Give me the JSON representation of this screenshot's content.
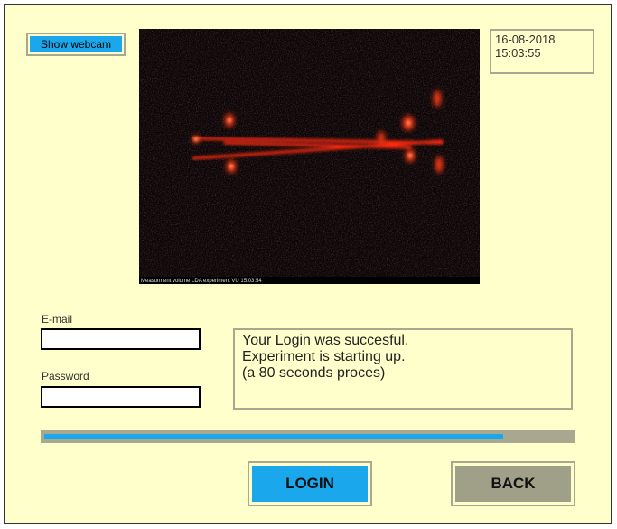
{
  "webcam": {
    "button_label": "Show webcam",
    "caption": "Measurment volume LDA experiment VU  15:03:54"
  },
  "datetime": {
    "date": "16-08-2018",
    "time": "15:03:55"
  },
  "form": {
    "email_label": "E-mail",
    "password_label": "Password",
    "email_value": "",
    "password_value": ""
  },
  "message": {
    "lines": [
      "Your Login was succesful.",
      "Experiment is starting up.",
      "(a 80 seconds proces)"
    ]
  },
  "progress": {
    "fraction": 0.87
  },
  "buttons": {
    "login": "LOGIN",
    "back": "BACK"
  },
  "colors": {
    "background": "#ffffcc",
    "accent": "#1aa7ec",
    "border": "#a8a890",
    "back_button": "#a0a088"
  }
}
